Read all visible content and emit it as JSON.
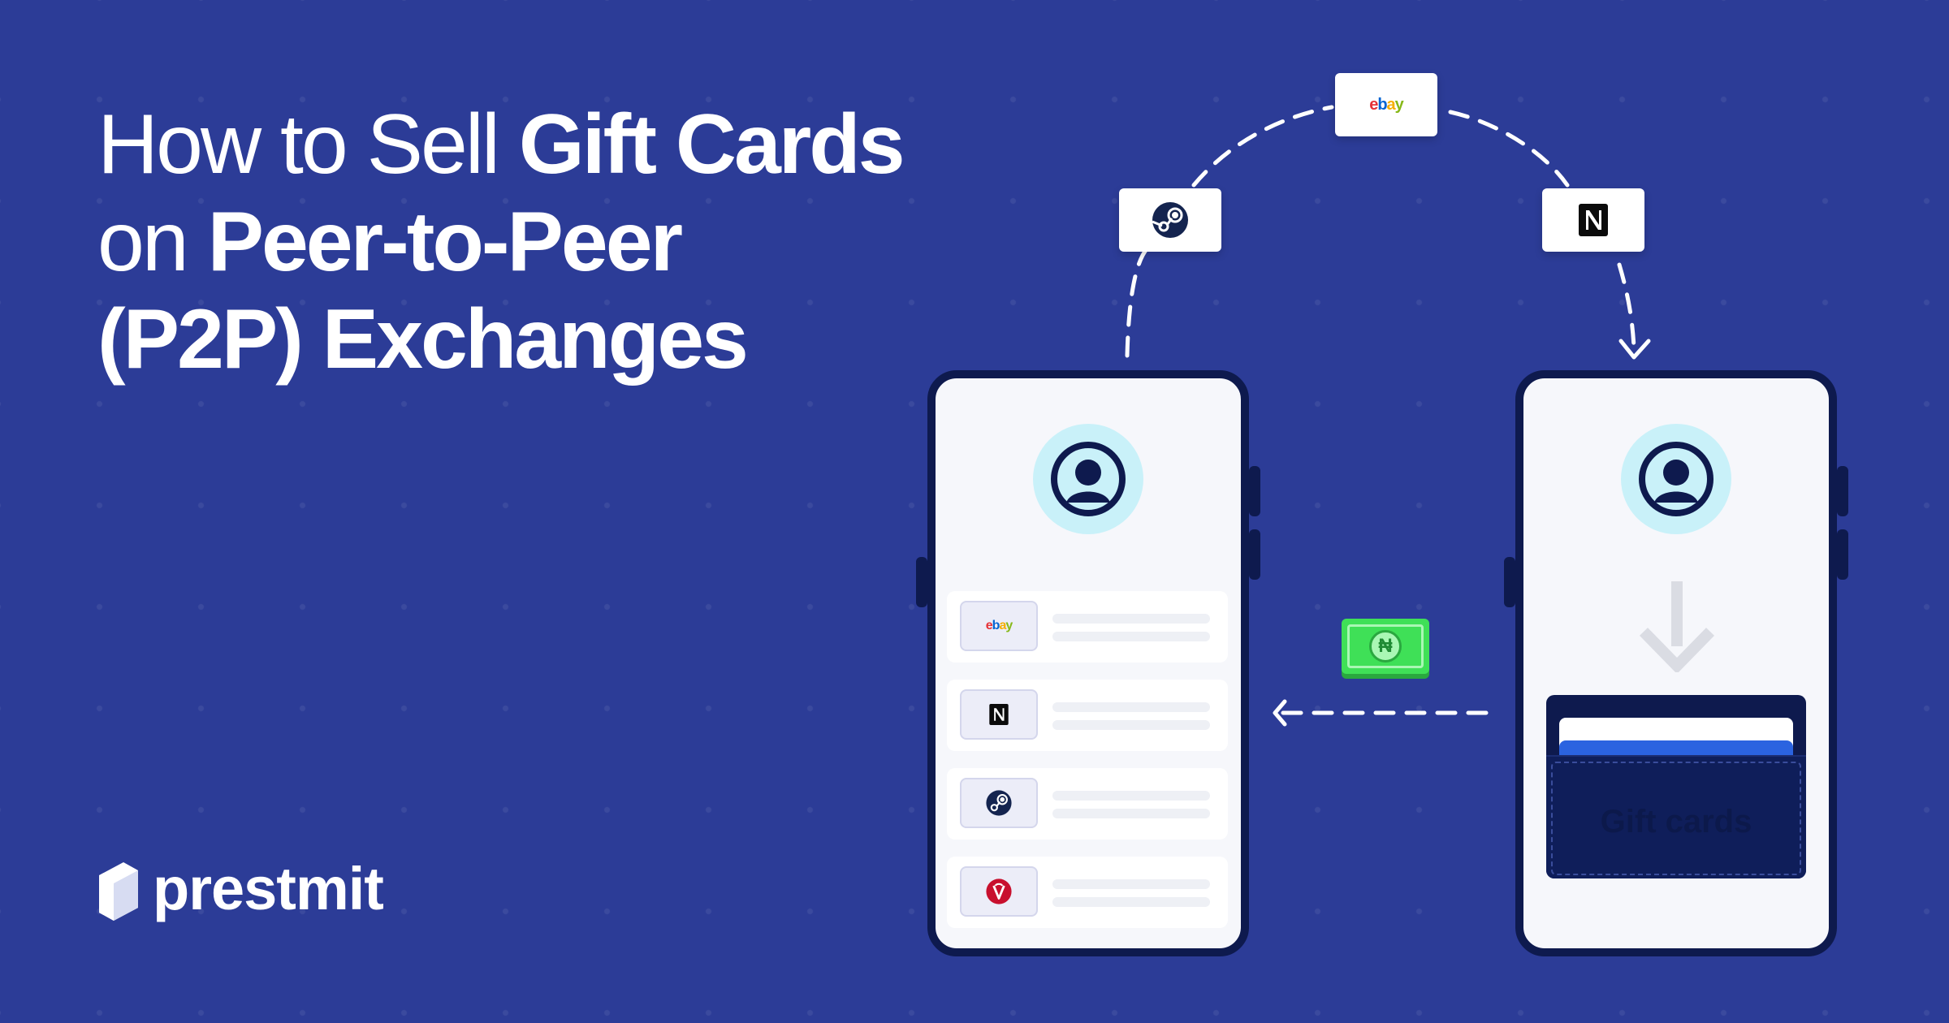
{
  "headline": {
    "line1_normal": "How to Sell ",
    "line1_bold": "Gift Cards",
    "line2_normal": "on ",
    "line2_bold": "Peer-to-Peer",
    "line3_bold": "(P2P) Exchanges"
  },
  "brand": {
    "name": "prestmit"
  },
  "floating_cards": {
    "left": {
      "icon": "steam-logo"
    },
    "center": {
      "text": "ebay"
    },
    "right": {
      "icon": "nordstrom-n-logo"
    }
  },
  "left_phone": {
    "rows": [
      {
        "logo_text": "ebay",
        "icon": "ebay-logo"
      },
      {
        "logo_text": "",
        "icon": "nordstrom-n-logo"
      },
      {
        "logo_text": "",
        "icon": "steam-logo"
      },
      {
        "logo_text": "",
        "icon": "vanilla-logo"
      }
    ]
  },
  "right_phone": {
    "wallet_label": "Gift cards"
  },
  "cash": {
    "symbol": "₦"
  },
  "colors": {
    "background": "#2c3c97",
    "phone_frame": "#0e1a4e",
    "avatar_ring": "#c9f1f9",
    "cash_green": "#3fe057"
  }
}
